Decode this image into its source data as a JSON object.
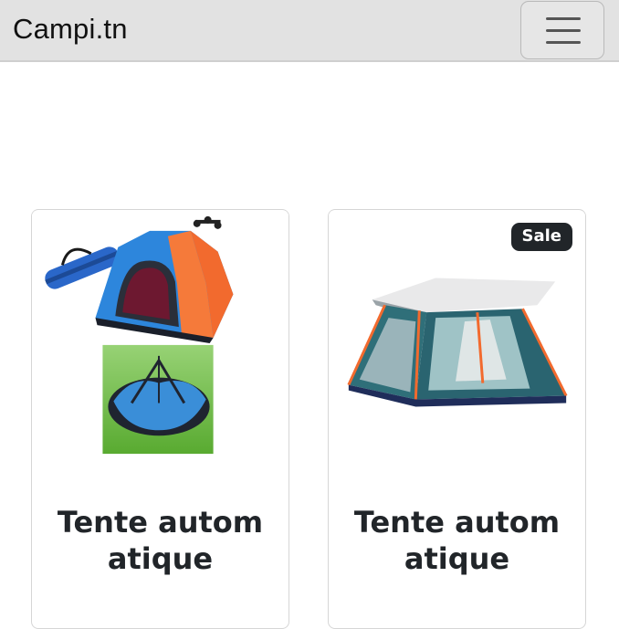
{
  "navbar": {
    "brand": "Campi.tn",
    "menu_icon": "hamburger-menu-icon"
  },
  "products": [
    {
      "title": "Tente automatique",
      "badge": "",
      "image": "pop-up tent with carry bag"
    },
    {
      "title": "Tente automatique",
      "badge": "Sale",
      "image": "green canopy tent"
    }
  ],
  "colors": {
    "navbar_bg": "#e2e2e2",
    "badge_bg": "#212529",
    "tent_blue": "#2d7fd3",
    "tent_orange": "#f26a2e",
    "tent_teal": "#2f6f79"
  }
}
